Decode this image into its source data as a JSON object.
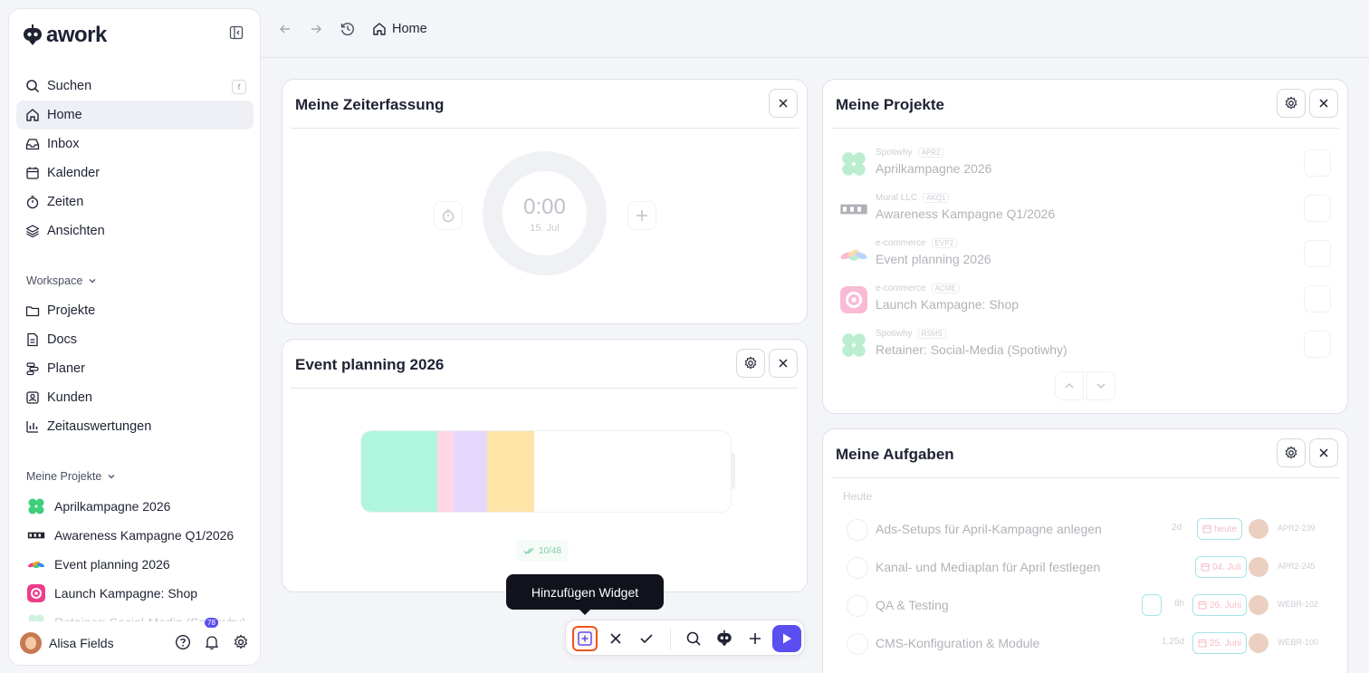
{
  "app": {
    "logo": "awork"
  },
  "sidebar": {
    "search": {
      "label": "Suchen",
      "shortcut": "f"
    },
    "nav": [
      {
        "label": "Home",
        "icon": "home-icon",
        "active": true
      },
      {
        "label": "Inbox",
        "icon": "inbox-icon"
      },
      {
        "label": "Kalender",
        "icon": "calendar-icon"
      },
      {
        "label": "Zeiten",
        "icon": "stopwatch-icon"
      },
      {
        "label": "Ansichten",
        "icon": "layers-icon"
      }
    ],
    "workspace_label": "Workspace",
    "workspace": [
      {
        "label": "Projekte",
        "icon": "folder-icon"
      },
      {
        "label": "Docs",
        "icon": "doc-icon"
      },
      {
        "label": "Planer",
        "icon": "planner-icon"
      },
      {
        "label": "Kunden",
        "icon": "users-icon"
      },
      {
        "label": "Zeitauswertungen",
        "icon": "chart-icon"
      }
    ],
    "projects_label": "Meine Projekte",
    "projects": [
      {
        "label": "Aprilkampagne 2026",
        "color": "#3ecf7a"
      },
      {
        "label": "Awareness Kampagne Q1/2026",
        "color": "#1e2233"
      },
      {
        "label": "Event planning 2026",
        "color": "#f4a020"
      },
      {
        "label": "Launch Kampagne: Shop",
        "color": "#ec3d8a"
      },
      {
        "label": "Retainer: Social-Media (Spotiwhy)",
        "color": "#3ecf7a"
      }
    ],
    "user": {
      "name": "Alisa Fields",
      "badge": "78"
    }
  },
  "topbar": {
    "breadcrumb": "Home"
  },
  "widgets": {
    "time": {
      "title": "Meine Zeiterfassung",
      "time": "0:00",
      "date": "15. Jul"
    },
    "event": {
      "title": "Event planning 2026",
      "progress": "10/48",
      "segments": [
        {
          "color": "#b0f5dd",
          "fraction": 0.205
        },
        {
          "color": "#ffd6e6",
          "fraction": 0.045
        },
        {
          "color": "#e5d8fc",
          "fraction": 0.09
        },
        {
          "color": "#ffe4a8",
          "fraction": 0.128
        }
      ]
    },
    "projects": {
      "title": "Meine Projekte",
      "items": [
        {
          "client": "Spotiwhy",
          "key": "APR2",
          "name": "Aprilkampagne 2026",
          "color": "#3ecf7a"
        },
        {
          "client": "Mural LLC",
          "key": "AKQ1",
          "name": "Awareness Kampagne Q1/2026",
          "color": "#1e2233"
        },
        {
          "client": "e-commerce",
          "key": "EVP2",
          "name": "Event planning 2026",
          "color": "#f4a020"
        },
        {
          "client": "e-commerce",
          "key": "ACME",
          "name": "Launch Kampagne: Shop",
          "color": "#ec3d8a"
        },
        {
          "client": "Spotiwhy",
          "key": "RSMS",
          "name": "Retainer: Social-Media (Spotiwhy)",
          "color": "#3ecf7a"
        }
      ]
    },
    "tasks": {
      "title": "Meine Aufgaben",
      "group": "Heute",
      "items": [
        {
          "name": "Ads-Setups für April-Kampagne anlegen",
          "duration": "2d",
          "date": "heute",
          "key": "APR2-239"
        },
        {
          "name": "Kanal- und Mediaplan für April festlegen",
          "date": "04. Juli",
          "key": "APR2-245"
        },
        {
          "name": "QA & Testing",
          "duration": "8h",
          "date": "26. Juni",
          "key": "WEBR-102"
        },
        {
          "name": "CMS-Konfiguration & Module",
          "duration": "1,25d",
          "date": "25. Juni",
          "key": "WEBR-100"
        }
      ]
    }
  },
  "tooltip": "Hinzufügen Widget"
}
